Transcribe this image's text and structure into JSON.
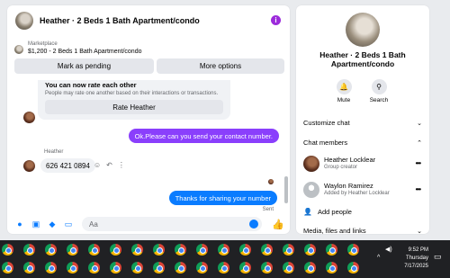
{
  "chat": {
    "title": "Heather · 2 Beds 1 Bath Apartment/condo",
    "marketplace_label": "Marketplace",
    "listing": "$1,200 - 2 Beds 1 Bath Apartment/condo",
    "mark_pending": "Mark as pending",
    "more_options": "More options",
    "rate_title": "You can now rate each other",
    "rate_sub": "People may rate one another based on their interactions or transactions.",
    "rate_button": "Rate Heather",
    "msg_out_1": "Ok.Please can you send your contact number.",
    "sender_name": "Heather",
    "msg_in_1": "626 421 0894",
    "msg_out_2": "Thanks for sharing your number",
    "sent_label": "Sent",
    "composer_placeholder": "Aa"
  },
  "info_panel": {
    "name": "Heather · 2 Beds 1 Bath Apartment/condo",
    "mute": "Mute",
    "search": "Search",
    "customize": "Customize chat",
    "members_title": "Chat members",
    "members": [
      {
        "name": "Heather Locklear",
        "role": "Group creator"
      },
      {
        "name": "Waylon Ramirez",
        "role": "Added by Heather Locklear"
      }
    ],
    "add_people": "Add people",
    "media": "Media, files and links"
  },
  "taskbar": {
    "time": "9:52 PM",
    "day": "Thursday",
    "date": "7/17/2025",
    "notif_count": "1"
  },
  "colors": {
    "purple_bubble": "#8a3ffc",
    "blue_bubble": "#0a7cff",
    "info_icon": "#9c2bdb"
  }
}
